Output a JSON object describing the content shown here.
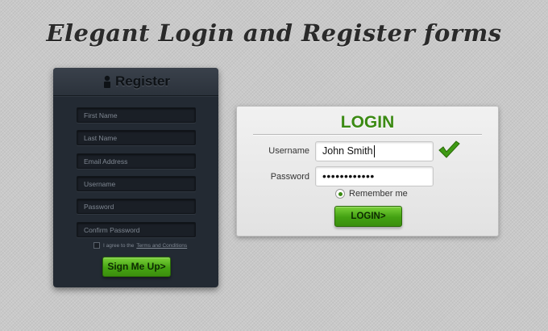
{
  "page": {
    "title": "Elegant Login and Register forms"
  },
  "register": {
    "title": "Register",
    "fields": [
      {
        "placeholder": "First Name"
      },
      {
        "placeholder": "Last Name"
      },
      {
        "placeholder": "Email Address"
      },
      {
        "placeholder": "Username"
      },
      {
        "placeholder": "Password"
      },
      {
        "placeholder": "Confirm Password"
      }
    ],
    "agree_text": "I agree to the",
    "terms_link": "Terms and Conditions",
    "submit_label": "Sign Me Up>"
  },
  "login": {
    "title": "LOGIN",
    "username_label": "Username",
    "username_value": "John Smith",
    "password_label": "Password",
    "password_value": "••••••••••••",
    "remember_label": "Remember me",
    "submit_label": "LOGIN>"
  },
  "colors": {
    "accent_green": "#3b8a13",
    "register_bg": "#232a33",
    "page_bg": "#c9c9c9"
  }
}
